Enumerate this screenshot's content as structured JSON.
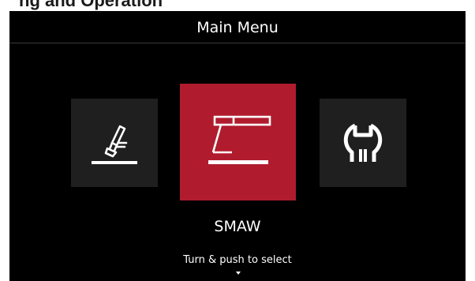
{
  "document": {
    "partial_heading": "ng and Operation"
  },
  "screen": {
    "title": "Main Menu",
    "menu": {
      "items": [
        {
          "id": "process",
          "icon": "torch-icon",
          "selected": false
        },
        {
          "id": "smaw",
          "icon": "stick-electrode-icon",
          "selected": true,
          "label": "SMAW"
        },
        {
          "id": "setup",
          "icon": "wrench-icon",
          "selected": false
        }
      ]
    },
    "selected_label": "SMAW",
    "hint": "Turn & push to select"
  },
  "colors": {
    "background": "#000000",
    "selected_tile": "#b01c2e",
    "tile": "#1f1f1f",
    "text": "#ffffff"
  }
}
